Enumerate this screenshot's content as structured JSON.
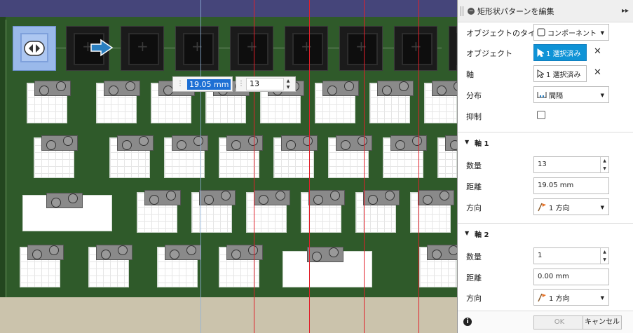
{
  "canvas": {
    "inline_distance_value": "19.05 mm",
    "inline_count_value": "13"
  },
  "panel": {
    "title": "矩形状パターンを編集",
    "rows": {
      "object_type": {
        "label": "オブジェクトのタイプ",
        "value": "コンポーネント"
      },
      "objects": {
        "label": "オブジェクト",
        "value": "1 選択済み"
      },
      "axis": {
        "label": "軸",
        "value": "1 選択済み"
      },
      "distribution": {
        "label": "分布",
        "value": "間隔"
      },
      "suppress": {
        "label": "抑制",
        "checked": false
      }
    },
    "axis1": {
      "title": "軸 1",
      "quantity_label": "数量",
      "quantity": "13",
      "distance_label": "距離",
      "distance": "19.05 mm",
      "direction_label": "方向",
      "direction": "1 方向"
    },
    "axis2": {
      "title": "軸 2",
      "quantity_label": "数量",
      "quantity": "1",
      "distance_label": "距離",
      "distance": "0.00 mm",
      "direction_label": "方向",
      "direction": "1 方向"
    },
    "footer": {
      "ok": "OK",
      "cancel": "キャンセル"
    }
  },
  "colors": {
    "board": "#2f5a2a",
    "selected_button": "#0f93d6",
    "pattern_lines": "#e0202a"
  }
}
